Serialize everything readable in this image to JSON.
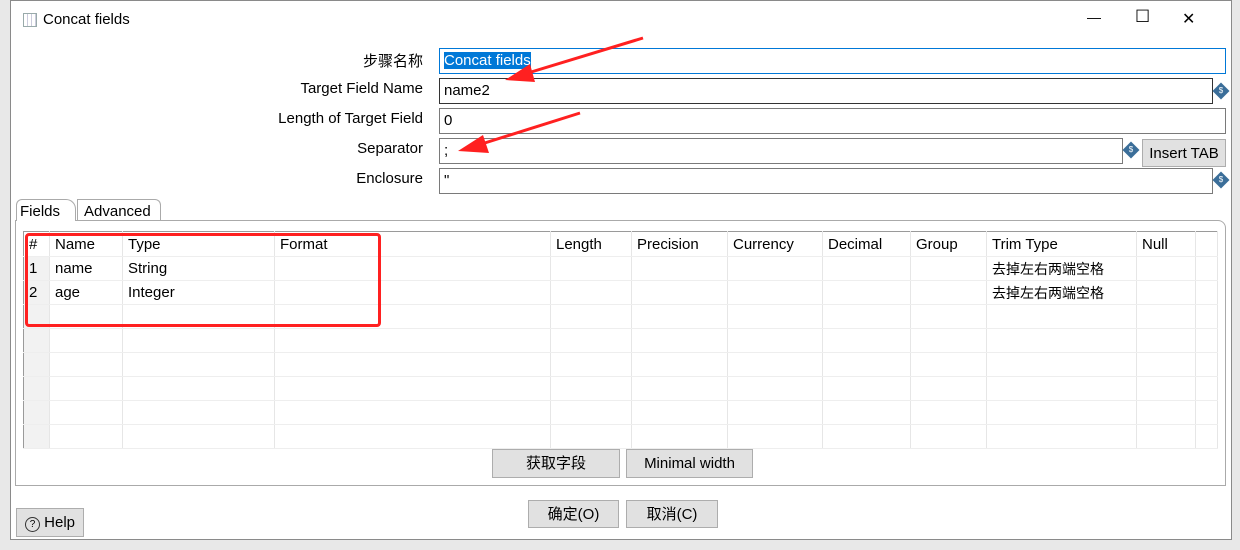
{
  "window": {
    "title": "Concat fields",
    "minimize": "—",
    "maximize": "☐",
    "close": "✕"
  },
  "form": {
    "step_name_label": "步骤名称",
    "step_name_value": "Concat fields",
    "target_field_label": "Target Field Name",
    "target_field_value": "name2",
    "length_label": "Length of Target Field",
    "length_value": "0",
    "separator_label": "Separator",
    "separator_value": ";",
    "insert_tab": "Insert TAB",
    "enclosure_label": "Enclosure",
    "enclosure_value": "\""
  },
  "tabs": [
    {
      "label": "Fields",
      "active": true
    },
    {
      "label": "Advanced",
      "active": false
    }
  ],
  "table": {
    "columns": [
      "#",
      "Name",
      "Type",
      "Format",
      "Length",
      "Precision",
      "Currency",
      "Decimal",
      "Group",
      "Trim Type",
      "Null"
    ],
    "rows": [
      [
        "1",
        "name",
        "String",
        "",
        "",
        "",
        "",
        "",
        "",
        "去掉左右两端空格",
        ""
      ],
      [
        "2",
        "age",
        "Integer",
        "",
        "",
        "",
        "",
        "",
        "",
        "去掉左右两端空格",
        ""
      ]
    ]
  },
  "buttons": {
    "get_fields": "获取字段",
    "minimal_width": "Minimal width",
    "ok": "确定(O)",
    "cancel": "取消(C)",
    "help": "Help"
  },
  "colors": {
    "annotation": "#ff2020",
    "selection": "#0078d7",
    "variable_icon": "#3b6e99"
  }
}
